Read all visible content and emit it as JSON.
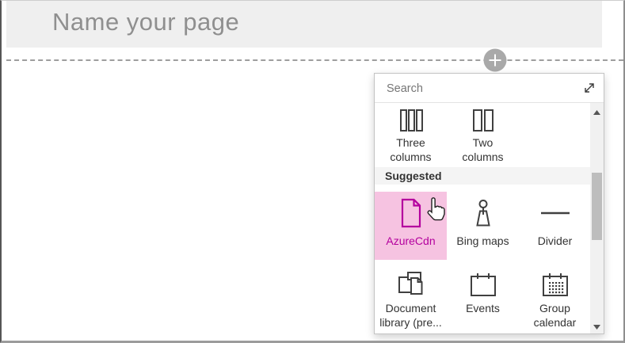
{
  "page_editor": {
    "title_placeholder": "Name your page"
  },
  "canvas": {
    "add_button_icon": "plus-circle-icon"
  },
  "toolbox": {
    "search": {
      "placeholder": "Search"
    },
    "expand_icon": "resize-diagonal-icon",
    "layout_items": [
      {
        "label": "Three\ncolumns",
        "icon": "three-columns-icon"
      },
      {
        "label": "Two\ncolumns",
        "icon": "two-columns-icon"
      }
    ],
    "suggested_header": "Suggested",
    "suggested_items": [
      {
        "label": "AzureCdn",
        "icon": "document-page-icon",
        "highlighted": true
      },
      {
        "label": "Bing maps",
        "icon": "map-pin-icon",
        "highlighted": false
      },
      {
        "label": "Divider",
        "icon": "divider-line-icon",
        "highlighted": false
      },
      {
        "label": "Document\nlibrary (pre...",
        "icon": "document-library-icon",
        "highlighted": false
      },
      {
        "label": "Events",
        "icon": "calendar-icon",
        "highlighted": false
      },
      {
        "label": "Group\ncalendar",
        "icon": "group-calendar-icon",
        "highlighted": false
      }
    ],
    "colors": {
      "highlight_bg": "#f6c3e1",
      "highlight_fg": "#b4009e",
      "icon_default": "#404040"
    }
  }
}
